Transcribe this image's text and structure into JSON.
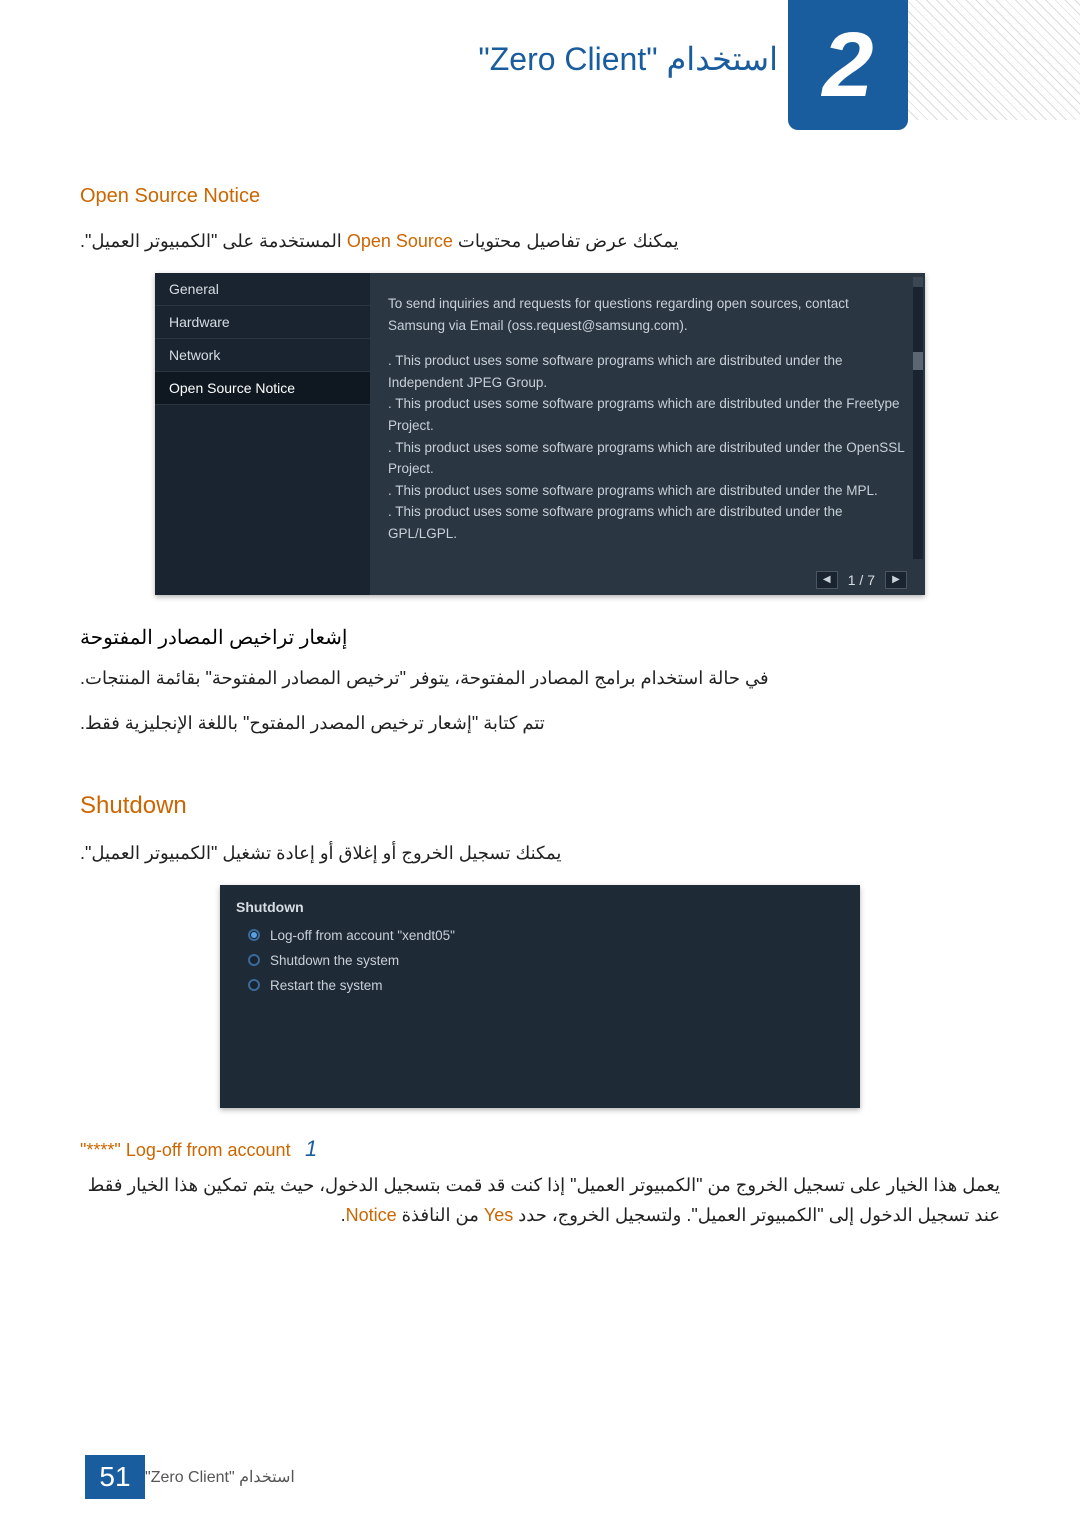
{
  "header": {
    "chapter_number": "2",
    "title": "استخدام \"Zero Client\""
  },
  "open_source_notice": {
    "heading": "Open Source Notice",
    "intro_pre": "يمكنك عرض تفاصيل محتويات ",
    "intro_highlight": "Open Source",
    "intro_post": " المستخدمة على \"الكمبيوتر العميل\"."
  },
  "screenshot1": {
    "sidebar": {
      "items": [
        {
          "label": "General"
        },
        {
          "label": "Hardware"
        },
        {
          "label": "Network"
        },
        {
          "label": "Open Source Notice"
        }
      ]
    },
    "body": {
      "intro": "To send inquiries and requests for questions regarding open sources, contact Samsung via Email (oss.request@samsung.com).",
      "lines": [
        ". This product uses some software programs which are distributed under the Independent JPEG Group.",
        ". This product uses some software programs which are distributed under the Freetype Project.",
        ". This product uses some software programs which are distributed under the OpenSSL Project.",
        ". This product uses some software programs which are distributed under the MPL.",
        ". This product uses some software programs which are distributed under the GPL/LGPL."
      ]
    },
    "pager": {
      "prev": "◀",
      "next": "▶",
      "indicator": "1 / 7"
    }
  },
  "after_ss1": {
    "sub_heading": "إشعار تراخيص المصادر المفتوحة",
    "line1": "في حالة استخدام برامج المصادر المفتوحة، يتوفر \"ترخيص المصادر المفتوحة\" بقائمة المنتجات.",
    "line2": "تتم كتابة \"إشعار ترخيص المصدر المفتوح\" باللغة الإنجليزية فقط."
  },
  "shutdown": {
    "heading": "Shutdown",
    "intro": "يمكنك تسجيل الخروج أو إغلاق أو إعادة تشغيل \"الكمبيوتر العميل\"."
  },
  "screenshot2": {
    "title": "Shutdown",
    "options": [
      {
        "label": "Log-off from account \"xendt05\"",
        "selected": true
      },
      {
        "label": "Shutdown the system",
        "selected": false
      },
      {
        "label": "Restart the system",
        "selected": false
      }
    ]
  },
  "logoff": {
    "number": "1",
    "heading": "Log-off from account \"****\"",
    "para_pre": "يعمل هذا الخيار على تسجيل الخروج من \"الكمبيوتر العميل\" إذا كنت قد قمت بتسجيل الدخول، حيث يتم تمكين هذا الخيار فقط عند تسجيل الدخول إلى \"الكمبيوتر العميل\". ولتسجيل الخروج، حدد ",
    "yes_word": "Yes",
    "para_mid": " من النافذة ",
    "notice_word": "Notice",
    "para_end": "."
  },
  "footer": {
    "text": "استخدام \"Zero Client\"",
    "page": "51"
  },
  "chart_data": null
}
